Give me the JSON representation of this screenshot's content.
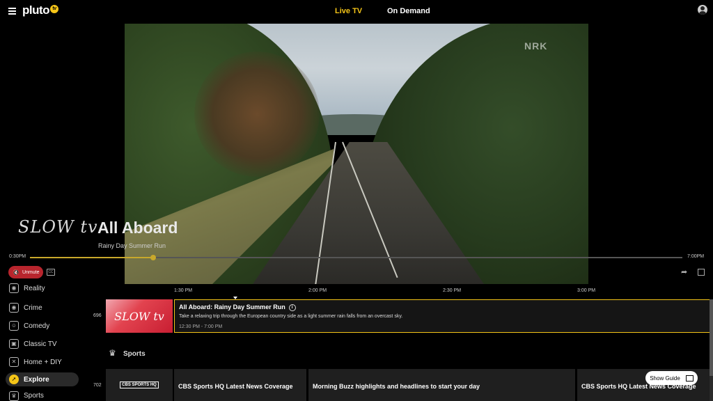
{
  "nav": {
    "logo": "pluto",
    "logo_badge": "tv",
    "tabs": [
      {
        "label": "Live TV",
        "active": true
      },
      {
        "label": "On Demand",
        "active": false
      }
    ]
  },
  "player": {
    "watermark": "NRK",
    "channel_logo": "SLOW tv",
    "show_title": "All Aboard",
    "episode_title": "Rainy Day Summer Run",
    "time_start": "0:30PM",
    "time_end": "7:00PM",
    "progress": 0.189,
    "unmute_label": "Unmute"
  },
  "sidebar": {
    "categories": [
      {
        "label": "Reality",
        "icon": "reality-icon",
        "active": false
      },
      {
        "label": "Crime",
        "icon": "crime-icon",
        "active": false
      },
      {
        "label": "Comedy",
        "icon": "comedy-icon",
        "active": false
      },
      {
        "label": "Classic TV",
        "icon": "classic-tv-icon",
        "active": false
      },
      {
        "label": "Home + DIY",
        "icon": "home-diy-icon",
        "active": false
      },
      {
        "label": "Explore",
        "icon": "compass-icon",
        "active": true
      },
      {
        "label": "Sports",
        "icon": "trophy-icon",
        "active": false
      }
    ]
  },
  "guide": {
    "time_ticks": [
      "1:30 PM",
      "2:00 PM",
      "2:30 PM",
      "3:00 PM"
    ],
    "rows": [
      {
        "channel_number": "696",
        "thumb_text": "SLOW tv",
        "program_title": "All Aboard: Rainy Day Summer Run",
        "program_desc": "Take a relaxing trip through the European country side as a light summer rain falls from an overcast sky.",
        "program_time": "12:30 PM - 7:00 PM"
      }
    ],
    "section_header": "Sports",
    "sports_row": {
      "channel_number": "702",
      "thumb_text": "CBS SPORTS HQ",
      "programs": [
        "CBS Sports HQ Latest News Coverage",
        "Morning Buzz highlights and headlines to start your day",
        "CBS Sports HQ Latest News Coverage"
      ]
    },
    "show_guide_label": "Show Guide"
  }
}
